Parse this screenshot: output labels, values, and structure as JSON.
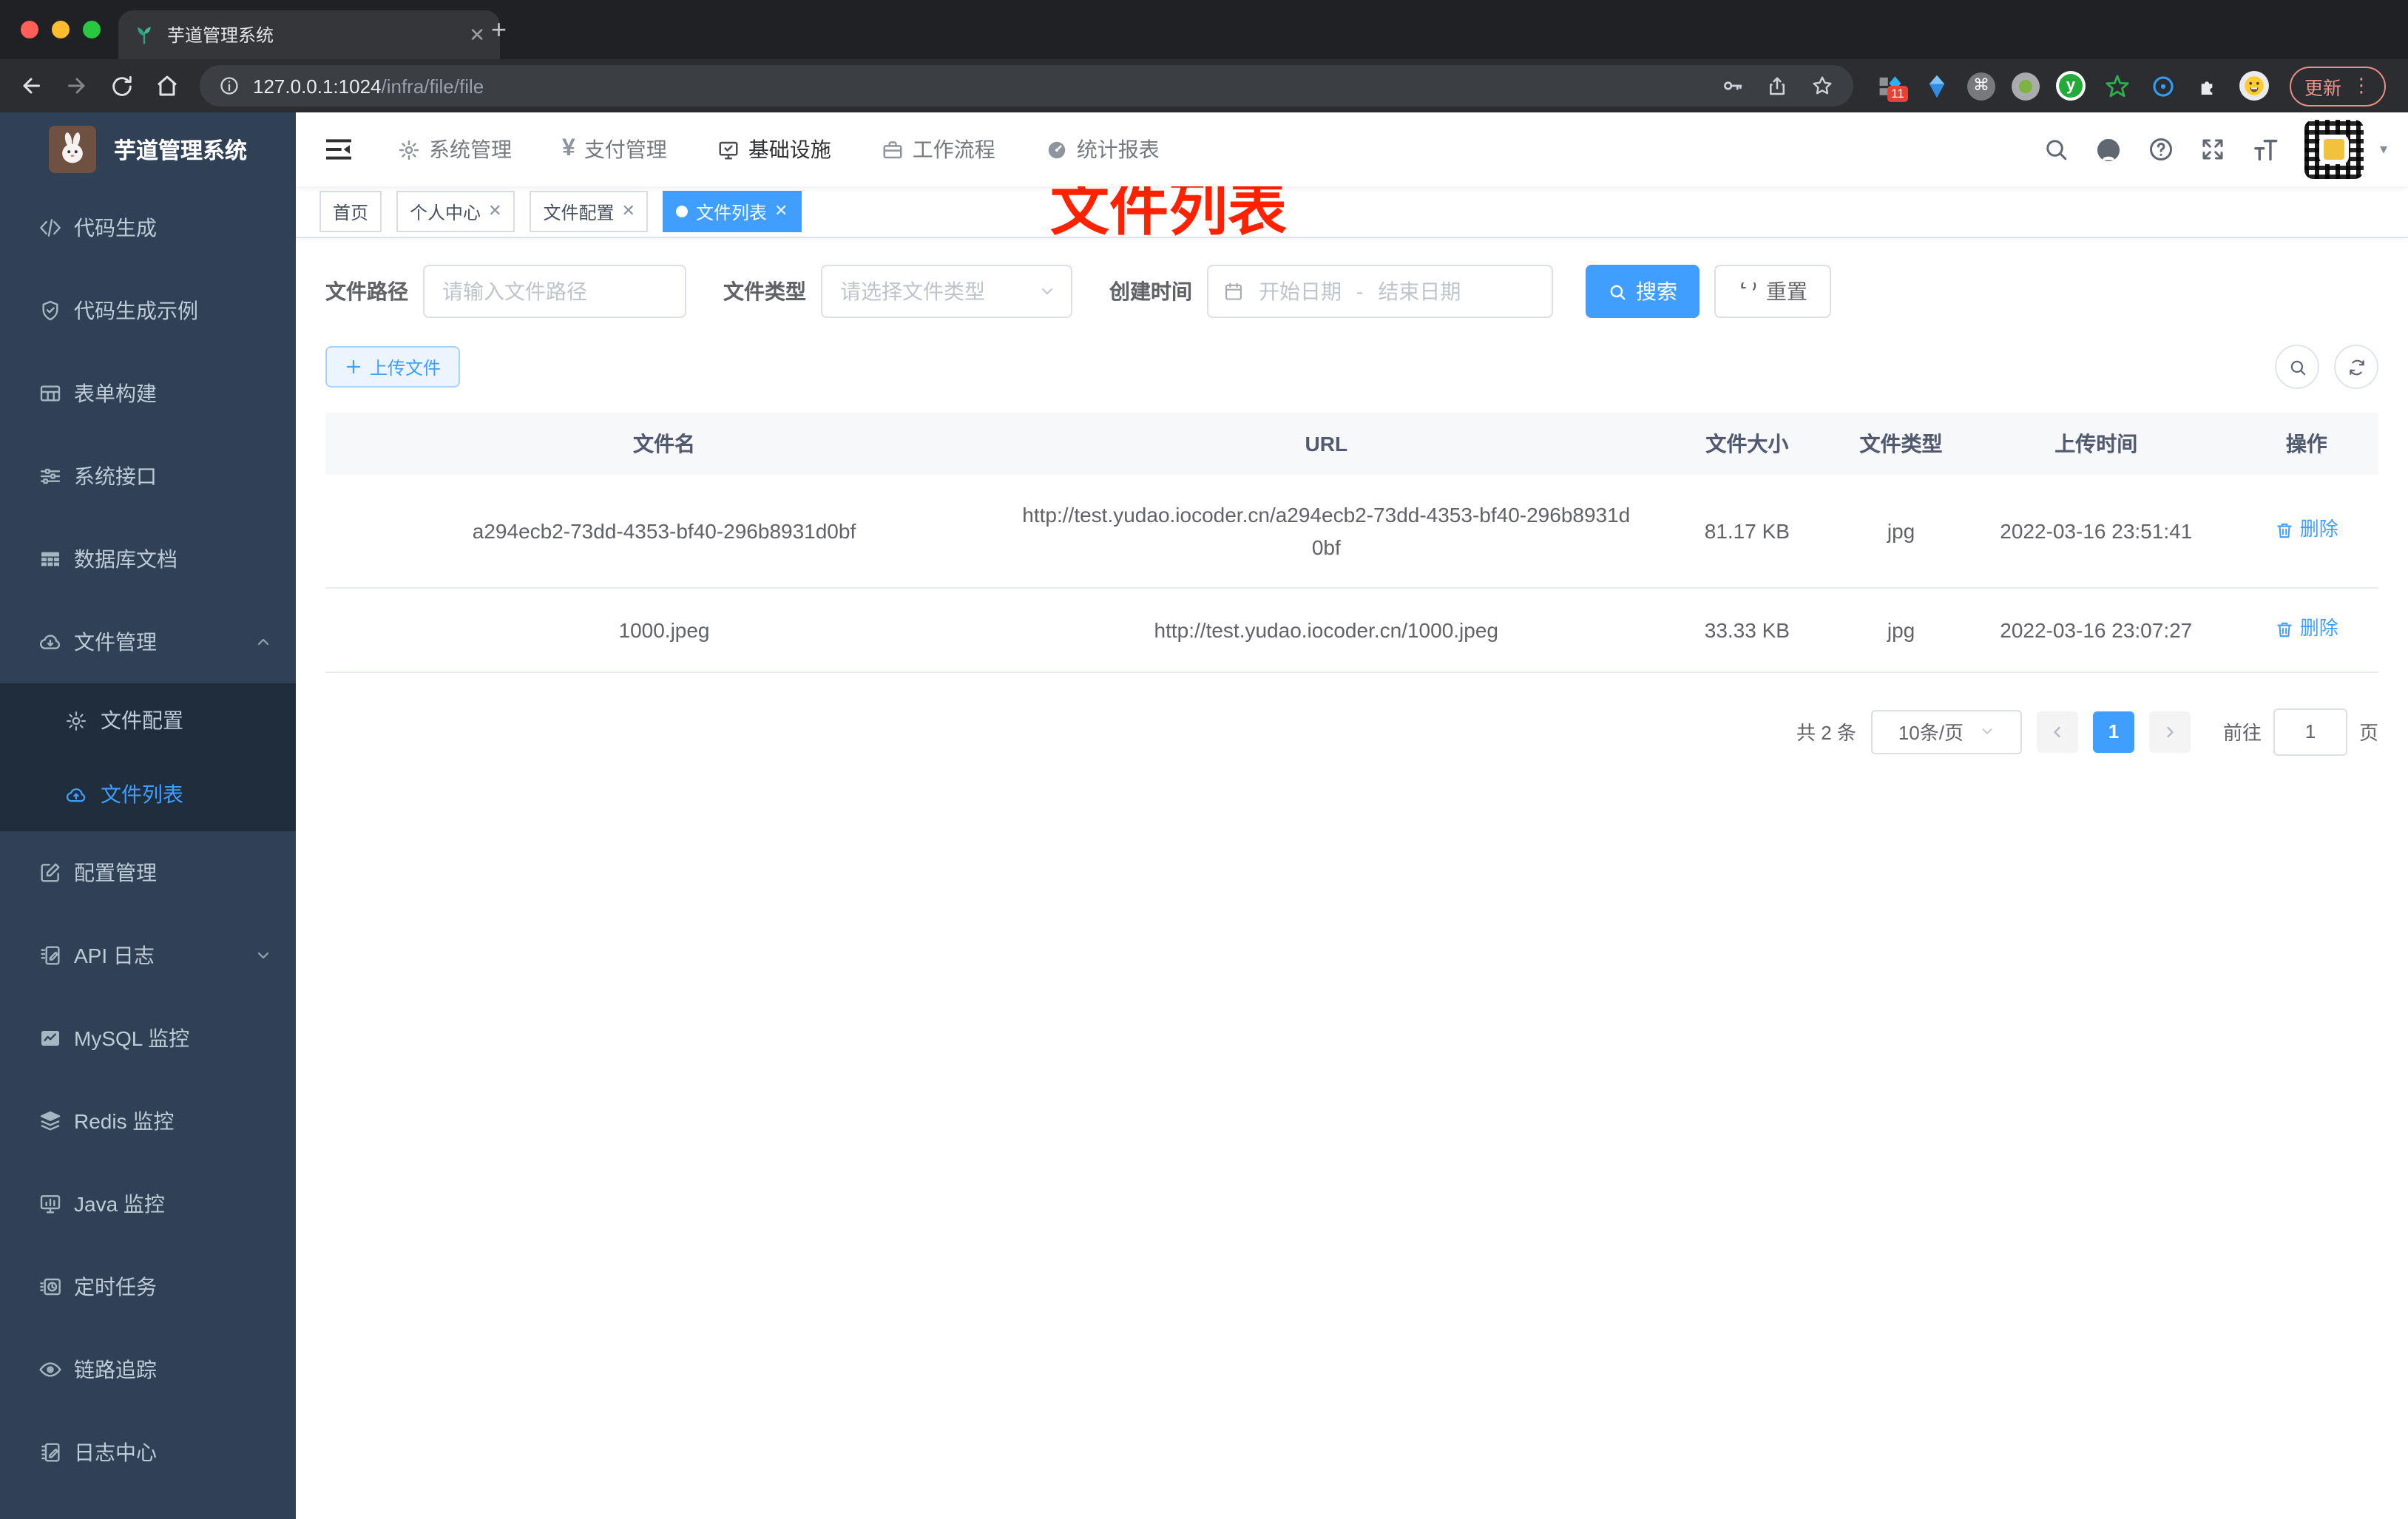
{
  "browser": {
    "tab_title": "芋道管理系统",
    "url_host": "127.0.0.1:1024",
    "url_path": "/infra/file/file",
    "new_tab_glyph": "+",
    "close_glyph": "✕",
    "extension_badge": "11",
    "cmd_glyph": "⌘",
    "y_logo": "y",
    "update_label": "更新",
    "menu_dots": "⋮",
    "avatar_caret": "▾"
  },
  "sidebar": {
    "logo_title": "芋道管理系统",
    "items": [
      {
        "label": "代码生成",
        "icon": "code-icon"
      },
      {
        "label": "代码生成示例",
        "icon": "shield-check-icon"
      },
      {
        "label": "表单构建",
        "icon": "form-grid-icon"
      },
      {
        "label": "系统接口",
        "icon": "sliders-icon"
      },
      {
        "label": "数据库文档",
        "icon": "database-table-icon"
      },
      {
        "label": "文件管理",
        "icon": "cloud-download-icon",
        "expanded": true
      },
      {
        "label": "文件配置",
        "icon": "gear-icon",
        "submenu": true
      },
      {
        "label": "文件列表",
        "icon": "cloud-upload-icon",
        "submenu": true,
        "active": true
      },
      {
        "label": "配置管理",
        "icon": "edit-square-icon"
      },
      {
        "label": "API 日志",
        "icon": "document-edit-icon",
        "collapsed": true
      },
      {
        "label": "MySQL 监控",
        "icon": "chart-monitor-icon"
      },
      {
        "label": "Redis 监控",
        "icon": "layers-icon"
      },
      {
        "label": "Java 监控",
        "icon": "monitor-icon"
      },
      {
        "label": "定时任务",
        "icon": "timer-icon"
      },
      {
        "label": "链路追踪",
        "icon": "eye-icon"
      },
      {
        "label": "日志中心",
        "icon": "log-edit-icon"
      }
    ]
  },
  "topnav": {
    "pay_glyph": "¥",
    "items": [
      {
        "label": "系统管理",
        "icon": "gear-icon"
      },
      {
        "label": "支付管理",
        "icon": "yen-icon"
      },
      {
        "label": "基础设施",
        "icon": "infra-monitor-icon",
        "active": true
      },
      {
        "label": "工作流程",
        "icon": "briefcase-icon"
      },
      {
        "label": "统计报表",
        "icon": "dashboard-icon"
      }
    ]
  },
  "tags": [
    {
      "label": "首页"
    },
    {
      "label": "个人中心",
      "closable": true
    },
    {
      "label": "文件配置",
      "closable": true
    },
    {
      "label": "文件列表",
      "closable": true,
      "active": true
    }
  ],
  "annotation_text": "文件列表",
  "filter": {
    "path_label": "文件路径",
    "path_placeholder": "请输入文件路径",
    "type_label": "文件类型",
    "type_placeholder": "请选择文件类型",
    "date_label": "创建时间",
    "date_start_placeholder": "开始日期",
    "date_separator": "-",
    "date_end_placeholder": "结束日期",
    "search_label": "搜索",
    "reset_label": "重置"
  },
  "toolbar": {
    "upload_label": "上传文件"
  },
  "table": {
    "headers": [
      "文件名",
      "URL",
      "文件大小",
      "文件类型",
      "上传时间",
      "操作"
    ],
    "rows": [
      {
        "name": "a294ecb2-73dd-4353-bf40-296b8931d0bf",
        "url": "http://test.yudao.iocoder.cn/a294ecb2-73dd-4353-bf40-296b8931d0bf",
        "size": "81.17 KB",
        "type": "jpg",
        "time": "2022-03-16 23:51:41",
        "action": "删除"
      },
      {
        "name": "1000.jpeg",
        "url": "http://test.yudao.iocoder.cn/1000.jpeg",
        "size": "33.33 KB",
        "type": "jpg",
        "time": "2022-03-16 23:07:27",
        "action": "删除"
      }
    ]
  },
  "pagination": {
    "total": "共 2 条",
    "page_size": "10条/页",
    "current_page": "1",
    "goto_label": "前往",
    "goto_value": "1",
    "page_unit": "页"
  },
  "colors": {
    "accent": "#409eff",
    "sidebar_bg": "#304156",
    "submenu_bg": "#1f2d3d",
    "annotation_red": "#ff2200"
  }
}
